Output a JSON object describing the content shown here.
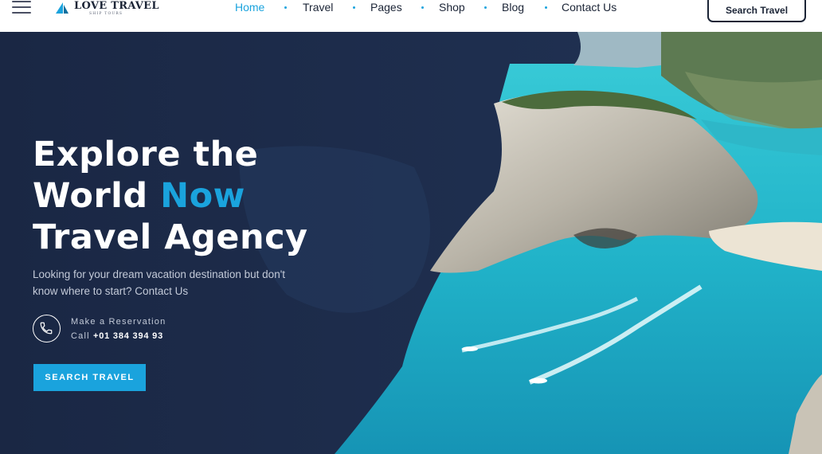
{
  "brand": {
    "name": "LOVE TRAVEL",
    "tagline": "SHIP TOURS"
  },
  "nav": {
    "items": [
      {
        "label": "Home",
        "active": true
      },
      {
        "label": "Travel",
        "active": false
      },
      {
        "label": "Pages",
        "active": false
      },
      {
        "label": "Shop",
        "active": false
      },
      {
        "label": "Blog",
        "active": false
      },
      {
        "label": "Contact Us",
        "active": false
      }
    ],
    "search_label": "Search Travel"
  },
  "hero": {
    "title_line1": "Explore the",
    "title_line2_prefix": "World",
    "title_line2_accent": "Now",
    "title_line3": "Travel Agency",
    "description": "Looking for your dream vacation destination but don't know where to start? Contact Us",
    "reservation_label": "Make a Reservation",
    "call_prefix": "Call",
    "phone": "+01 384 394 93",
    "cta_label": "SEARCH TRAVEL"
  },
  "colors": {
    "accent": "#1aa3dd",
    "navy": "#1b2436",
    "hero_bg": "#1c2b4a",
    "sea": "#2bbfd0"
  },
  "icons": [
    "menu-icon",
    "logo-sail-icon",
    "phone-icon"
  ]
}
